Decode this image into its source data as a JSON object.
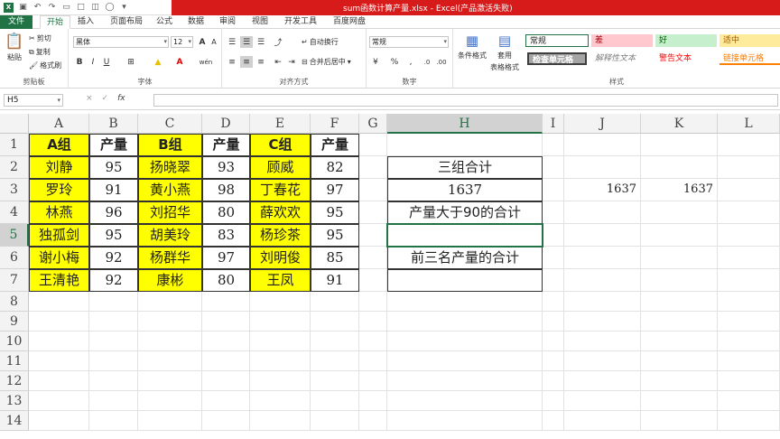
{
  "window": {
    "title": "sum函数计算产量.xlsx -  Excel(产品激活失败)"
  },
  "tabs": [
    "文件",
    "开始",
    "插入",
    "页面布局",
    "公式",
    "数据",
    "审阅",
    "视图",
    "开发工具",
    "百度网盘"
  ],
  "ribbon": {
    "clipboard": {
      "label": "剪贴板",
      "paste": "粘贴",
      "cut": "剪切",
      "copy": "复制",
      "format_painter": "格式刷"
    },
    "font": {
      "label": "字体",
      "name": "黑体",
      "size": "12",
      "bold": "B",
      "italic": "I",
      "underline": "U",
      "grow": "A",
      "shrink": "A",
      "wen": "wén"
    },
    "alignment": {
      "label": "对齐方式",
      "wrap": "自动换行",
      "merge": "合并后居中"
    },
    "number": {
      "label": "数字",
      "format": "常规",
      "percent": "%",
      "comma": ","
    },
    "styles": {
      "label": "样式",
      "cond_format": "条件格式",
      "table_format_1": "套用",
      "table_format_2": "表格格式",
      "items": [
        {
          "text": "常规",
          "bg": "#ffffff",
          "color": "#000000"
        },
        {
          "text": "差",
          "bg": "#ffc7ce",
          "color": "#9c0006"
        },
        {
          "text": "好",
          "bg": "#c6efce",
          "color": "#006100"
        },
        {
          "text": "适中",
          "bg": "#ffeb9c",
          "color": "#9c5700"
        },
        {
          "text": "检查单元格",
          "bg": "#a5a5a5",
          "color": "#ffffff"
        },
        {
          "text": "解释性文本",
          "bg": "#ffffff",
          "color": "#7f7f7f"
        },
        {
          "text": "警告文本",
          "bg": "#ffffff",
          "color": "#ff0000"
        },
        {
          "text": "链接单元格",
          "bg": "#ffffff",
          "color": "#fa7d00"
        }
      ]
    }
  },
  "formula_bar": {
    "name_box": "H5",
    "cancel": "×",
    "enter": "✓",
    "fx": "fx",
    "value": ""
  },
  "columns": [
    "A",
    "B",
    "C",
    "D",
    "E",
    "F",
    "G",
    "H",
    "I",
    "J",
    "K",
    "L"
  ],
  "rows": [
    "1",
    "2",
    "3",
    "4",
    "5",
    "6",
    "7",
    "8",
    "9",
    "10",
    "11",
    "12",
    "13",
    "14"
  ],
  "sheet": {
    "headers": [
      "A组",
      "产量",
      "B组",
      "产量",
      "C组",
      "产量"
    ],
    "data": [
      [
        "刘静",
        "95",
        "扬晓翠",
        "93",
        "顾威",
        "82"
      ],
      [
        "罗玲",
        "91",
        "黄小燕",
        "98",
        "丁春花",
        "97"
      ],
      [
        "林燕",
        "96",
        "刘招华",
        "80",
        "薛欢欢",
        "95"
      ],
      [
        "独孤剑",
        "95",
        "胡美玲",
        "83",
        "杨珍茶",
        "95"
      ],
      [
        "谢小梅",
        "92",
        "杨群华",
        "97",
        "刘明俊",
        "85"
      ],
      [
        "王清艳",
        "92",
        "康彬",
        "80",
        "王凤",
        "91"
      ]
    ],
    "h_cells": [
      "",
      "三组合计",
      "1637",
      "产量大于90的合计",
      "",
      "前三名产量的合计",
      ""
    ],
    "j3": "1637",
    "k3": "1637"
  },
  "colors": {
    "accent": "#217346",
    "title_bar": "#d71a1a",
    "highlight": "#ffff00"
  }
}
